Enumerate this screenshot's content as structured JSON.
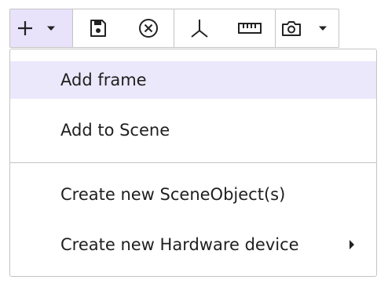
{
  "toolbar": {
    "icons": {
      "add": "plus-icon",
      "add_caret": "caret-down-icon",
      "save": "floppy-disk-icon",
      "clear": "circle-x-icon",
      "axes": "axes-icon",
      "measure": "ruler-icon",
      "snapshot": "camera-icon",
      "snapshot_caret": "caret-down-icon"
    },
    "active_color": "#e8e2fb"
  },
  "menu": {
    "items": [
      {
        "label": "Add frame",
        "highlighted": true
      },
      {
        "label": "Add to Scene"
      },
      {
        "label": "Create new SceneObject(s)"
      },
      {
        "label": "Create new Hardware device",
        "submenu_icon": "caret-right-icon"
      }
    ],
    "highlight_color": "#ece8fb"
  }
}
